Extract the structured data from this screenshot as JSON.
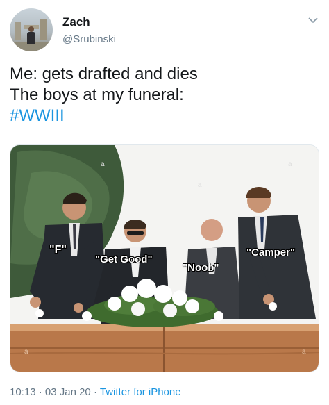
{
  "author": {
    "name": "Zach",
    "handle": "@Srubinski",
    "avatar_icon": "profile-photo"
  },
  "menu_icon": "chevron-down-icon",
  "tweet": {
    "lines": [
      "Me: gets drafted and dies",
      "The boys at my funeral:"
    ],
    "hashtag": "#WWIII"
  },
  "media": {
    "captions": [
      "\"F\"",
      "\"Get Good\"",
      "\"Noob\"",
      "\"Camper\""
    ]
  },
  "meta": {
    "time": "10:13",
    "separator1": "·",
    "date": "03 Jan 20",
    "separator2": "·",
    "source": "Twitter for iPhone"
  },
  "colors": {
    "link": "#1b95e0",
    "secondary_text": "#657786",
    "primary_text": "#14171a"
  }
}
